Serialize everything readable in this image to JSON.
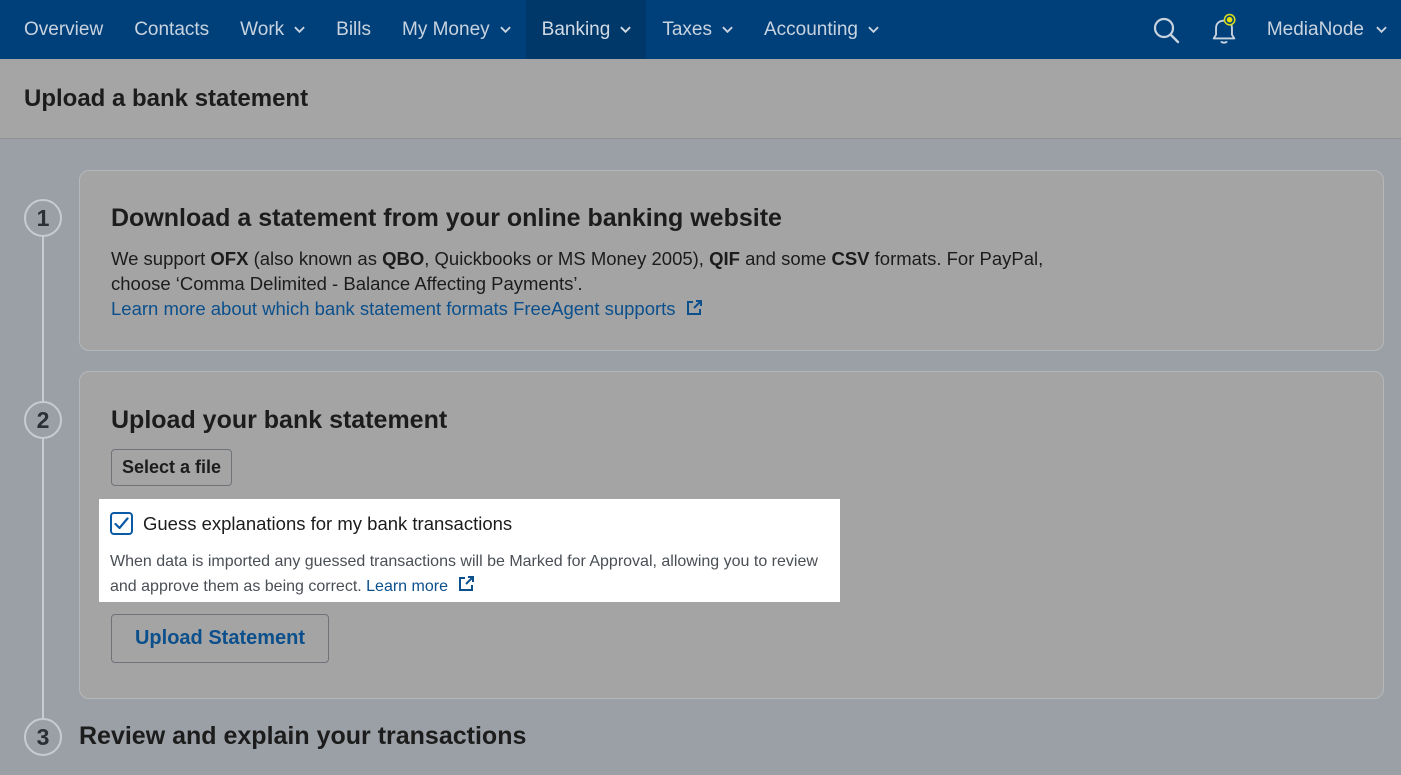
{
  "nav": {
    "items": [
      {
        "label": "Overview",
        "dropdown": false
      },
      {
        "label": "Contacts",
        "dropdown": false
      },
      {
        "label": "Work",
        "dropdown": true
      },
      {
        "label": "Bills",
        "dropdown": false
      },
      {
        "label": "My Money",
        "dropdown": true
      },
      {
        "label": "Banking",
        "dropdown": true,
        "active": true
      },
      {
        "label": "Taxes",
        "dropdown": true
      },
      {
        "label": "Accounting",
        "dropdown": true
      }
    ],
    "user": "MediaNode",
    "icons": [
      "search-icon",
      "bell-icon"
    ],
    "colors": {
      "bar": "#00407a",
      "active": "#00386a",
      "notification_dot": "#e8e000"
    }
  },
  "page": {
    "title": "Upload a bank statement"
  },
  "steps": [
    {
      "number": "1",
      "title": "Download a statement from your online banking website",
      "desc_parts": [
        "We support ",
        "OFX",
        " (also known as ",
        "QBO",
        ", Quickbooks or MS Money 2005), ",
        "QIF",
        " and some ",
        "CSV",
        " formats. For PayPal, choose ‘Comma Delimited - Balance Affecting Payments’."
      ],
      "link": "Learn more about which bank statement formats FreeAgent supports"
    },
    {
      "number": "2",
      "title": "Upload your bank statement",
      "select_button": "Select a file",
      "checkbox_label": "Guess explanations for my bank transactions",
      "checkbox_checked": true,
      "help_text": "When data is imported any guessed transactions will be Marked for Approval, allowing you to review and approve them as being correct.",
      "help_link": "Learn more",
      "upload_button": "Upload Statement"
    },
    {
      "number": "3",
      "title": "Review and explain your transactions"
    }
  ]
}
